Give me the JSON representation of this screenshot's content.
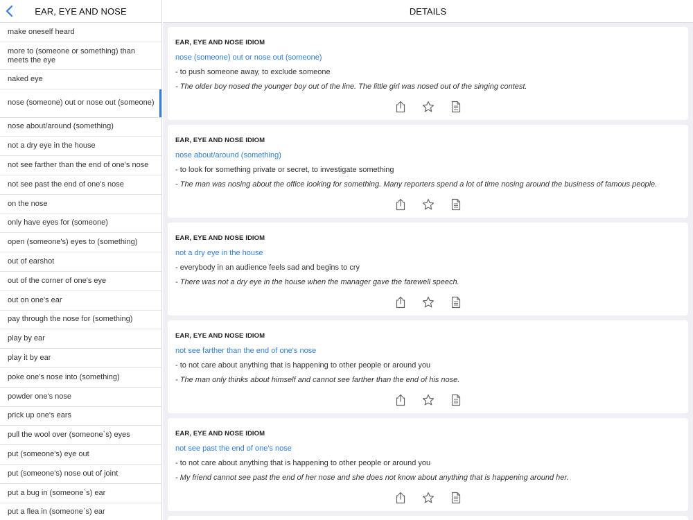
{
  "sidebar": {
    "title": "EAR, EYE AND NOSE",
    "items": [
      {
        "label": "make oneself heard",
        "lines": 1
      },
      {
        "label": "more to (someone or something) than meets the eye",
        "lines": 2
      },
      {
        "label": "naked eye",
        "lines": 1
      },
      {
        "label": "nose (someone) out or nose out (someone)",
        "lines": 2,
        "selected": true
      },
      {
        "label": "nose about/around (something)",
        "lines": 1
      },
      {
        "label": "not a dry eye in the house",
        "lines": 1
      },
      {
        "label": "not see farther than the end of one's nose",
        "lines": 1
      },
      {
        "label": "not see past the end of one's nose",
        "lines": 1
      },
      {
        "label": "on the nose",
        "lines": 1
      },
      {
        "label": "only have eyes for (someone)",
        "lines": 1
      },
      {
        "label": "open (someone's) eyes to (something)",
        "lines": 1
      },
      {
        "label": "out of earshot",
        "lines": 1
      },
      {
        "label": "out of the corner of one's eye",
        "lines": 1
      },
      {
        "label": "out on one's ear",
        "lines": 1
      },
      {
        "label": "pay through the nose for (something)",
        "lines": 1
      },
      {
        "label": "play by ear",
        "lines": 1
      },
      {
        "label": "play it by ear",
        "lines": 1
      },
      {
        "label": "poke one's nose into (something)",
        "lines": 1
      },
      {
        "label": "powder one's nose",
        "lines": 1
      },
      {
        "label": "prick up one's ears",
        "lines": 1
      },
      {
        "label": "pull the wool over (someone`s) eyes",
        "lines": 1
      },
      {
        "label": "put (someone's) eye out",
        "lines": 1
      },
      {
        "label": "put (someone's) nose out of joint",
        "lines": 1
      },
      {
        "label": "put a bug in (someone`s) ear",
        "lines": 1
      },
      {
        "label": "put a flea in (someone`s) ear",
        "lines": 1
      }
    ]
  },
  "main": {
    "title": "DETAILS",
    "cards": [
      {
        "kicker": "EAR, EYE AND NOSE IDIOM",
        "title": "nose (someone) out or nose out (someone)",
        "definition": "- to push someone away, to exclude someone",
        "example": "- The older boy nosed the younger boy out of the line. The little girl was nosed out of the singing contest."
      },
      {
        "kicker": "EAR, EYE AND NOSE IDIOM",
        "title": "nose about/around (something)",
        "definition": "- to look for something private or secret, to investigate something",
        "example": "- The man was nosing about the office looking for something. Many reporters spend a lot of time nosing around the business of famous people."
      },
      {
        "kicker": "EAR, EYE AND NOSE IDIOM",
        "title": "not a dry eye in the house",
        "definition": "- everybody in an audience feels sad and begins to cry",
        "example": "- There was not a dry eye in the house when the manager gave the farewell speech."
      },
      {
        "kicker": "EAR, EYE AND NOSE IDIOM",
        "title": "not see farther than the end of one's nose",
        "definition": "- to not care about anything that is happening to other people or around you",
        "example": "- The man only thinks about himself and cannot see farther than the end of his nose."
      },
      {
        "kicker": "EAR, EYE AND NOSE IDIOM",
        "title": "not see past the end of one's nose",
        "definition": "- to not care about anything that is happening to other people or around you",
        "example": "- My friend cannot see past the end of her nose and she does not know about anything that is happening around her."
      }
    ]
  },
  "colors": {
    "accent": "#2b7de9",
    "background": "#efeff4",
    "icon": "#666666"
  },
  "icons": {
    "back": "chevron-left-icon",
    "share": "share-icon",
    "favorite": "star-icon",
    "note": "document-icon"
  }
}
